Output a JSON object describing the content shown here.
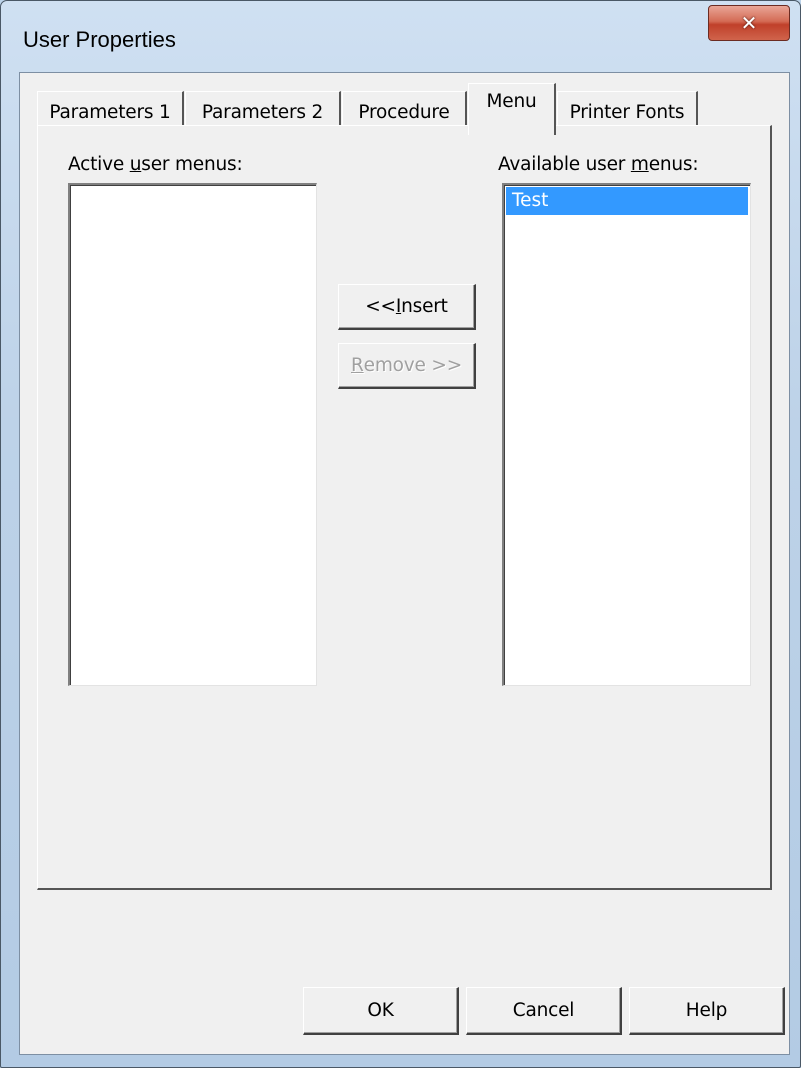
{
  "window": {
    "title": "User Properties"
  },
  "tabs": [
    {
      "label": "Parameters 1",
      "active": false
    },
    {
      "label": "Parameters 2",
      "active": false
    },
    {
      "label": "Procedure",
      "active": false
    },
    {
      "label": "Menu",
      "active": true
    },
    {
      "label": "Printer Fonts",
      "active": false
    }
  ],
  "menu_tab": {
    "active_label": {
      "pre": "Active ",
      "mnemonic": "u",
      "post": "ser menus:"
    },
    "available_label": {
      "pre": "Available user ",
      "mnemonic": "m",
      "post": "enus:"
    },
    "active_items": [],
    "available_items": [
      {
        "label": "Test",
        "selected": true
      }
    ],
    "insert_button": {
      "pre": "<< ",
      "mnemonic": "I",
      "post": "nsert",
      "enabled": true
    },
    "remove_button": {
      "pre": "",
      "mnemonic": "R",
      "post": "emove >>",
      "enabled": false
    }
  },
  "footer": {
    "ok": "OK",
    "cancel": "Cancel",
    "help": "Help"
  },
  "icons": {
    "close": "close-icon"
  },
  "colors": {
    "selection": "#3399ff",
    "close_button": "#c0402a",
    "dialog_bg": "#f0f0f0"
  }
}
